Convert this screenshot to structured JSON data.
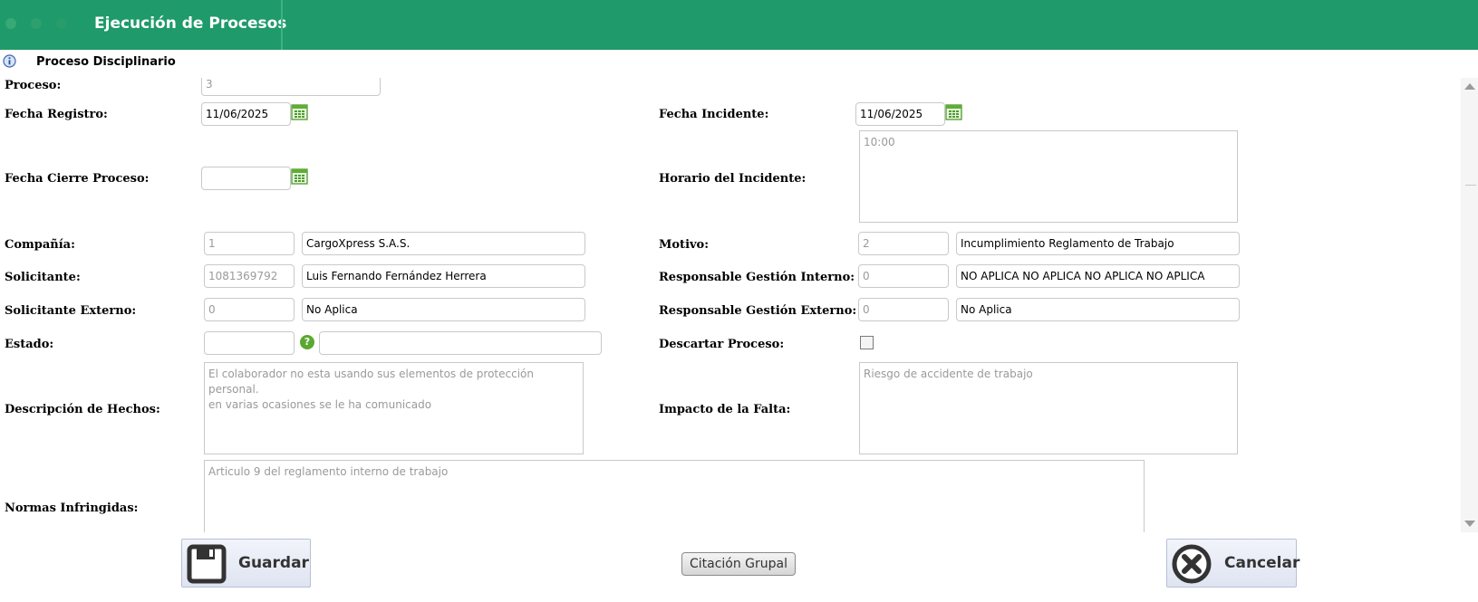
{
  "header": {
    "title": "Ejecución de Procesos",
    "bg_color": "#1f9a6a"
  },
  "section": {
    "title": "Proceso Disciplinario"
  },
  "form": {
    "proceso": {
      "label": "Proceso:",
      "value": "3"
    },
    "fecha_registro": {
      "label": "Fecha Registro:",
      "value": "11/06/2025"
    },
    "fecha_incidente": {
      "label": "Fecha Incidente:",
      "value": "11/06/2025"
    },
    "fecha_cierre": {
      "label": "Fecha Cierre Proceso:",
      "value": ""
    },
    "horario_incidente": {
      "label": "Horario del Incidente:",
      "value": "10:00"
    },
    "compania": {
      "label": "Compañía:",
      "code": "1",
      "name": "CargoXpress S.A.S."
    },
    "motivo": {
      "label": "Motivo:",
      "code": "2",
      "name": "Incumplimiento Reglamento de Trabajo"
    },
    "solicitante": {
      "label": "Solicitante:",
      "code": "1081369792",
      "name": "Luis Fernando Fernández Herrera"
    },
    "resp_interno": {
      "label": "Responsable Gestión Interno:",
      "code": "0",
      "name": "NO APLICA NO APLICA NO APLICA NO APLICA"
    },
    "solicitante_externo": {
      "label": "Solicitante Externo:",
      "code": "0",
      "name": "No Aplica"
    },
    "resp_externo": {
      "label": "Responsable Gestión Externo:",
      "code": "0",
      "name": "No Aplica"
    },
    "estado": {
      "label": "Estado:",
      "code": "",
      "name": ""
    },
    "descartar": {
      "label": "Descartar Proceso:",
      "checked": false
    },
    "descripcion": {
      "label": "Descripción de Hechos:",
      "line1": "El colaborador no esta usando sus elementos de protección personal.",
      "line2": "en varias ocasiones se le ha comunicado"
    },
    "impacto": {
      "label": "Impacto de la Falta:",
      "value": "Riesgo de accidente de trabajo"
    },
    "normas": {
      "label": "Normas Infringidas:",
      "value": "Articulo 9 del reglamento interno de trabajo"
    }
  },
  "buttons": {
    "guardar": "Guardar",
    "citacion": "Citación Grupal",
    "cancelar": "Cancelar"
  }
}
